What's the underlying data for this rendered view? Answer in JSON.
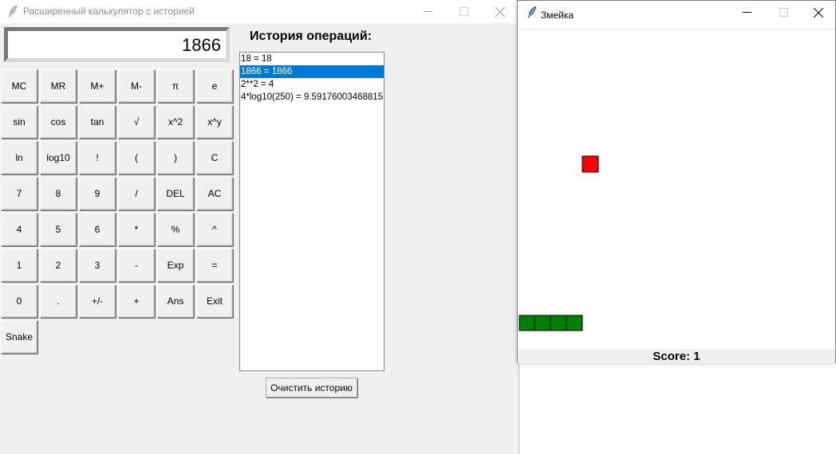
{
  "calculator": {
    "window_title": "Расширенный калькулятор с историей",
    "display": "1866",
    "buttons": [
      [
        "MC",
        "MR",
        "M+",
        "M-",
        "π",
        "e"
      ],
      [
        "sin",
        "cos",
        "tan",
        "√",
        "x^2",
        "x^y"
      ],
      [
        "ln",
        "log10",
        "!",
        "(",
        ")",
        "C"
      ],
      [
        "7",
        "8",
        "9",
        "/",
        "DEL",
        "AC"
      ],
      [
        "4",
        "5",
        "6",
        "*",
        "%",
        "^"
      ],
      [
        "1",
        "2",
        "3",
        "-",
        "Exp",
        "="
      ],
      [
        "0",
        ".",
        "+/-",
        "+",
        "Ans",
        "Exit"
      ],
      [
        "Snake"
      ]
    ],
    "history_title": "История операций:",
    "history": [
      {
        "text": "18 = 18",
        "selected": false
      },
      {
        "text": "1866 = 1866",
        "selected": true
      },
      {
        "text": "2**2 = 4",
        "selected": false
      },
      {
        "text": "4*log10(250) = 9.59176003468815",
        "selected": false
      }
    ],
    "clear_history_label": "Очистить историю"
  },
  "snake_window": {
    "window_title": "Змейка",
    "score_label": "Score: 1",
    "colors": {
      "food": "#ff0000",
      "snake": "#008000",
      "segment_border": "#000000"
    }
  },
  "colors": {
    "selection": "#0078d7",
    "window_bg": "#f0f0f0"
  }
}
